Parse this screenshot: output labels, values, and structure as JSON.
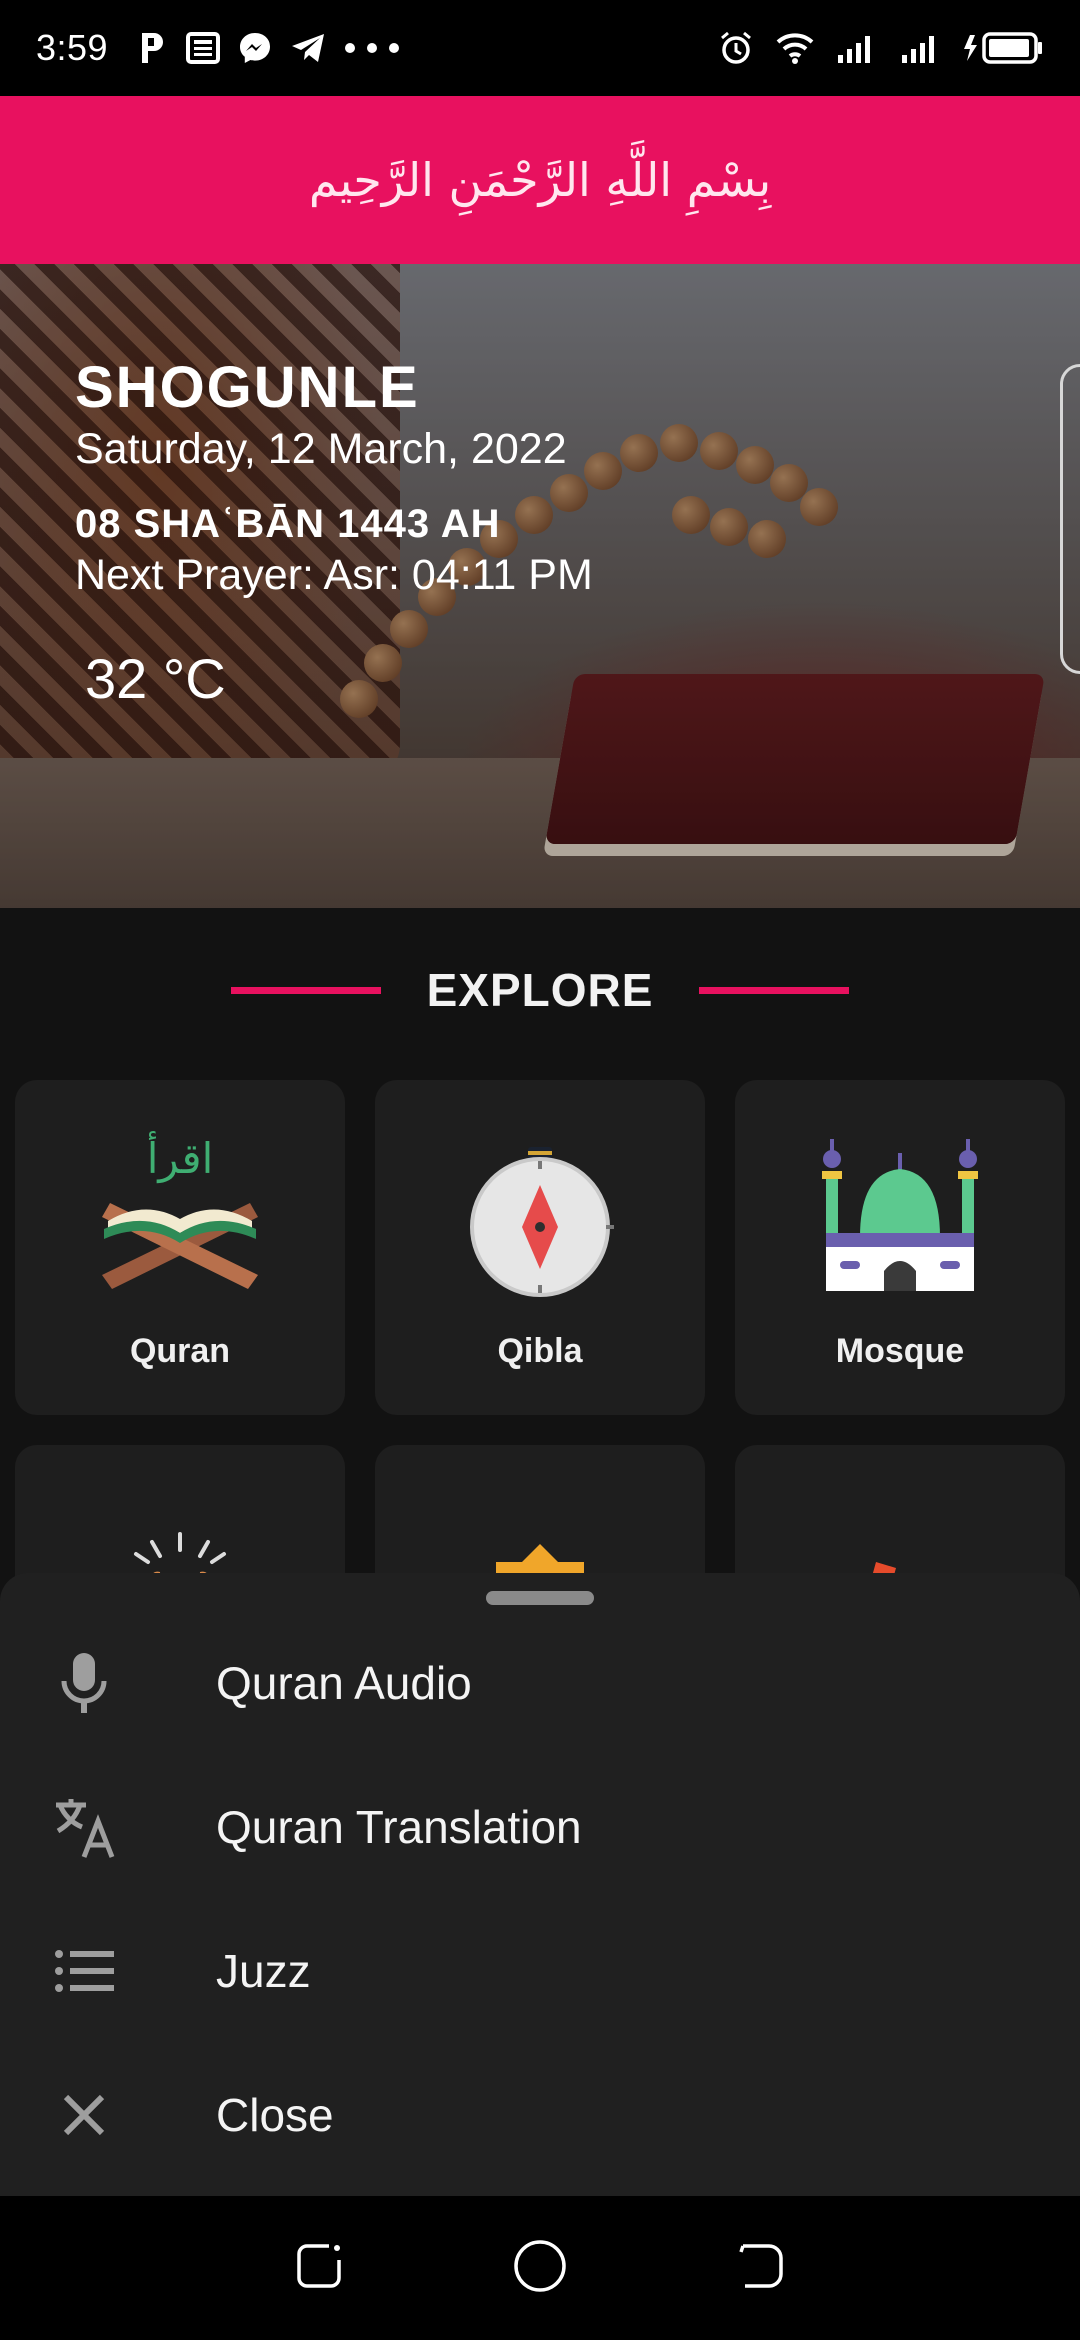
{
  "status_bar": {
    "time": "3:59",
    "icons_left": [
      "p-icon",
      "news-icon",
      "messenger-icon",
      "telegram-icon",
      "more-dots-icon"
    ],
    "icons_right": [
      "alarm-icon",
      "wifi-icon",
      "signal-icon",
      "signal-icon",
      "charging-battery-icon"
    ]
  },
  "header": {
    "bismillah": "بِسْمِ اللَّهِ الرَّحْمَنِ الرَّحِيم"
  },
  "hero": {
    "city": "SHOGUNLE",
    "date": "Saturday, 12 March, 2022",
    "hijri_date": "08 SHAʿBĀN 1443 AH",
    "next_prayer": "Next Prayer: Asr: 04:11 PM",
    "temperature": "32 °C"
  },
  "explore": {
    "title": "EXPLORE",
    "cards": [
      {
        "label": "Quran",
        "icon": "quran-icon"
      },
      {
        "label": "Qibla",
        "icon": "compass-icon"
      },
      {
        "label": "Mosque",
        "icon": "mosque-icon"
      },
      {
        "label": "",
        "icon": "dua-hands-icon"
      },
      {
        "label": "",
        "icon": "calendar-icon"
      },
      {
        "label": "",
        "icon": "book-icon"
      }
    ]
  },
  "bottom_sheet": {
    "items": [
      {
        "label": "Quran Audio",
        "icon": "microphone-icon"
      },
      {
        "label": "Quran Translation",
        "icon": "translate-icon"
      },
      {
        "label": "Juzz",
        "icon": "list-icon"
      },
      {
        "label": "Close",
        "icon": "close-icon"
      }
    ]
  },
  "nav_bar": {
    "buttons": [
      "recents-button",
      "home-button",
      "back-button"
    ]
  },
  "colors": {
    "accent": "#e8115f",
    "background": "#121212",
    "card": "#1e1e1e",
    "sheet": "#202020"
  }
}
